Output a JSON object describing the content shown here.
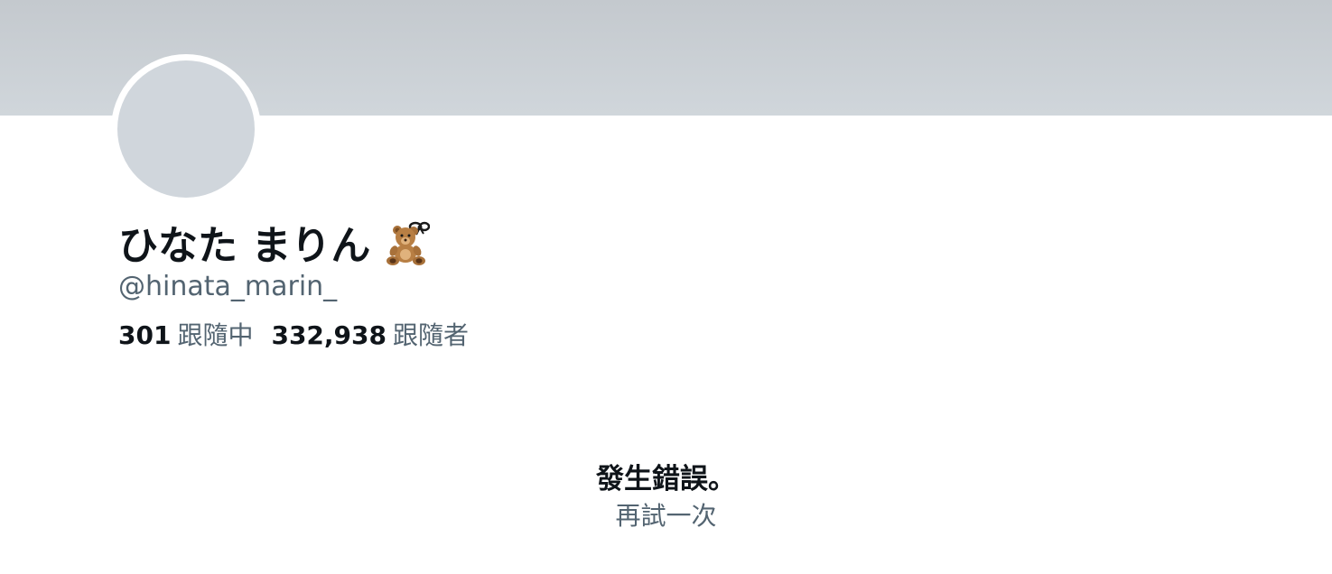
{
  "profile": {
    "display_name": "ひなた まりん",
    "emoji_icon": "teddy-bear-with-ribbon-icon",
    "handle": "@hinata_marin_",
    "following_count": "301",
    "following_label": "跟隨中",
    "followers_count": "332,938",
    "followers_label": "跟隨者"
  },
  "error": {
    "title": "發生錯誤。",
    "retry_label": "再試一次"
  },
  "colors": {
    "banner": "#c4c9ce",
    "avatar_placeholder": "#d0d6dc",
    "primary_text": "#0f1419",
    "secondary_text": "#536471"
  }
}
